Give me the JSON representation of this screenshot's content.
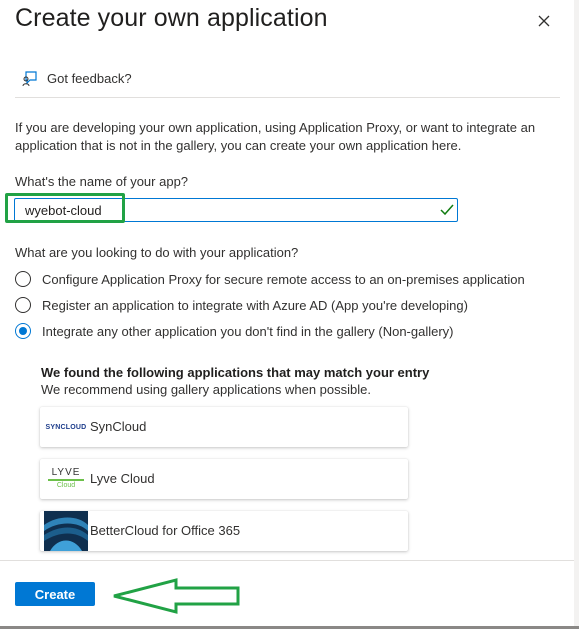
{
  "panel": {
    "title": "Create your own application",
    "feedback_label": "Got feedback?",
    "intro": "If you are developing your own application, using Application Proxy, or want to integrate an application that is not in the gallery, you can create your own application here."
  },
  "name_field": {
    "label": "What's the name of your app?",
    "value": "wyebot-cloud",
    "valid": true
  },
  "purpose": {
    "label": "What are you looking to do with your application?",
    "options": [
      {
        "label": "Configure Application Proxy for secure remote access to an on-premises application",
        "selected": false
      },
      {
        "label": "Register an application to integrate with Azure AD (App you're developing)",
        "selected": false
      },
      {
        "label": "Integrate any other application you don't find in the gallery (Non-gallery)",
        "selected": true
      }
    ]
  },
  "matches": {
    "title": "We found the following applications that may match your entry",
    "subtitle": "We recommend using gallery applications when possible.",
    "apps": [
      {
        "name": "SynCloud",
        "logo_text": "SYNCLOUD",
        "icon": "syncloud-logo"
      },
      {
        "name": "Lyve Cloud",
        "logo_text": "LYVE",
        "logo_sub": "Cloud",
        "icon": "lyve-cloud-logo"
      },
      {
        "name": "BetterCloud for Office 365",
        "icon": "bettercloud-logo"
      }
    ]
  },
  "footer": {
    "create_label": "Create"
  },
  "colors": {
    "accent": "#0078d4",
    "annotation": "#21a245",
    "text": "#323130"
  }
}
